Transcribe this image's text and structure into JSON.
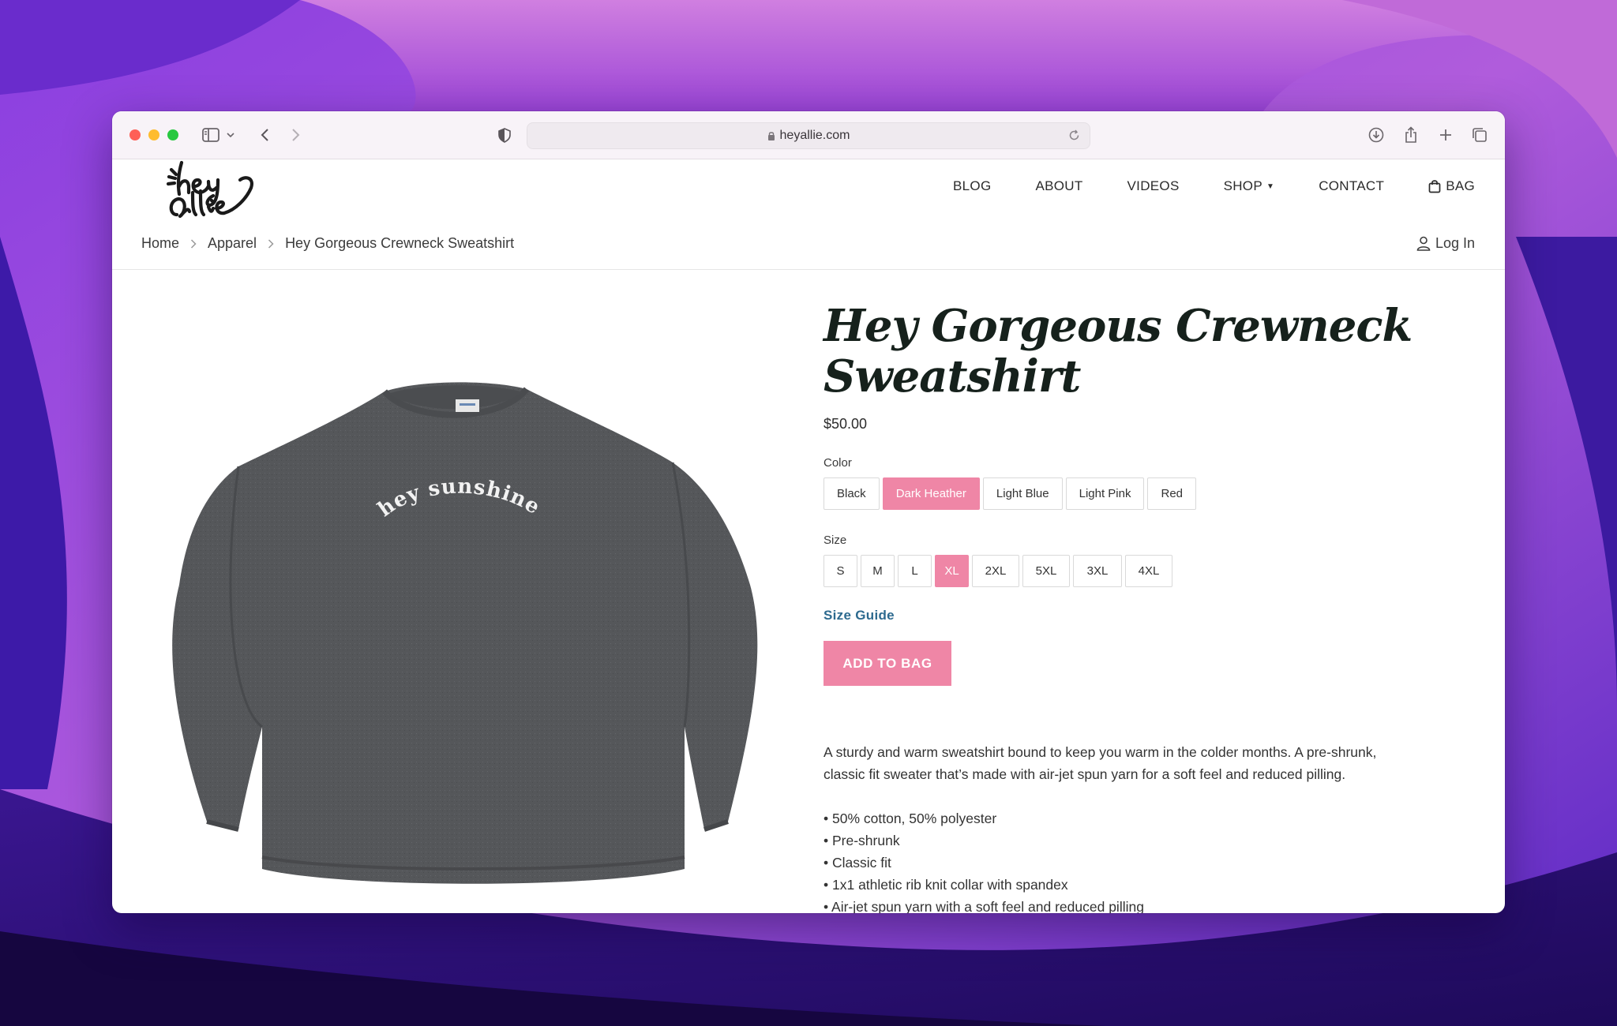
{
  "browser": {
    "url": "heyallie.com"
  },
  "site": {
    "logo_text": "hey allie",
    "nav": [
      {
        "label": "BLOG"
      },
      {
        "label": "ABOUT"
      },
      {
        "label": "VIDEOS"
      },
      {
        "label": "SHOP"
      },
      {
        "label": "CONTACT"
      },
      {
        "label": "BAG"
      }
    ],
    "login_label": "Log In"
  },
  "breadcrumb": [
    "Home",
    "Apparel",
    "Hey Gorgeous Crewneck Sweatshirt"
  ],
  "product": {
    "image_print_text": "hey sunshine",
    "title_line1": "Hey Gorgeous Crewneck",
    "title_line2": "Sweatshirt",
    "price": "$50.00",
    "color_label": "Color",
    "colors": [
      "Black",
      "Dark Heather",
      "Light Blue",
      "Light Pink",
      "Red"
    ],
    "selected_color": "Dark Heather",
    "size_label": "Size",
    "sizes": [
      "S",
      "M",
      "L",
      "XL",
      "2XL",
      "5XL",
      "3XL",
      "4XL"
    ],
    "selected_size": "XL",
    "size_guide_label": "Size Guide",
    "add_button_label": "ADD TO BAG",
    "description_line1": "A sturdy and warm sweatshirt bound to keep you warm in the colder months. A pre-shrunk,",
    "description_line2": "classic fit sweater that’s made with air-jet spun yarn for a soft feel and reduced pilling.",
    "features": [
      "50% cotton, 50% polyester",
      "Pre-shrunk",
      "Classic fit",
      "1x1 athletic rib knit collar with spandex",
      "Air-jet spun yarn with a soft feel and reduced pilling"
    ]
  },
  "colors": {
    "accent_pink": "#ef86a6",
    "link_blue": "#2d6a8f",
    "sweatshirt": "#55575a"
  }
}
